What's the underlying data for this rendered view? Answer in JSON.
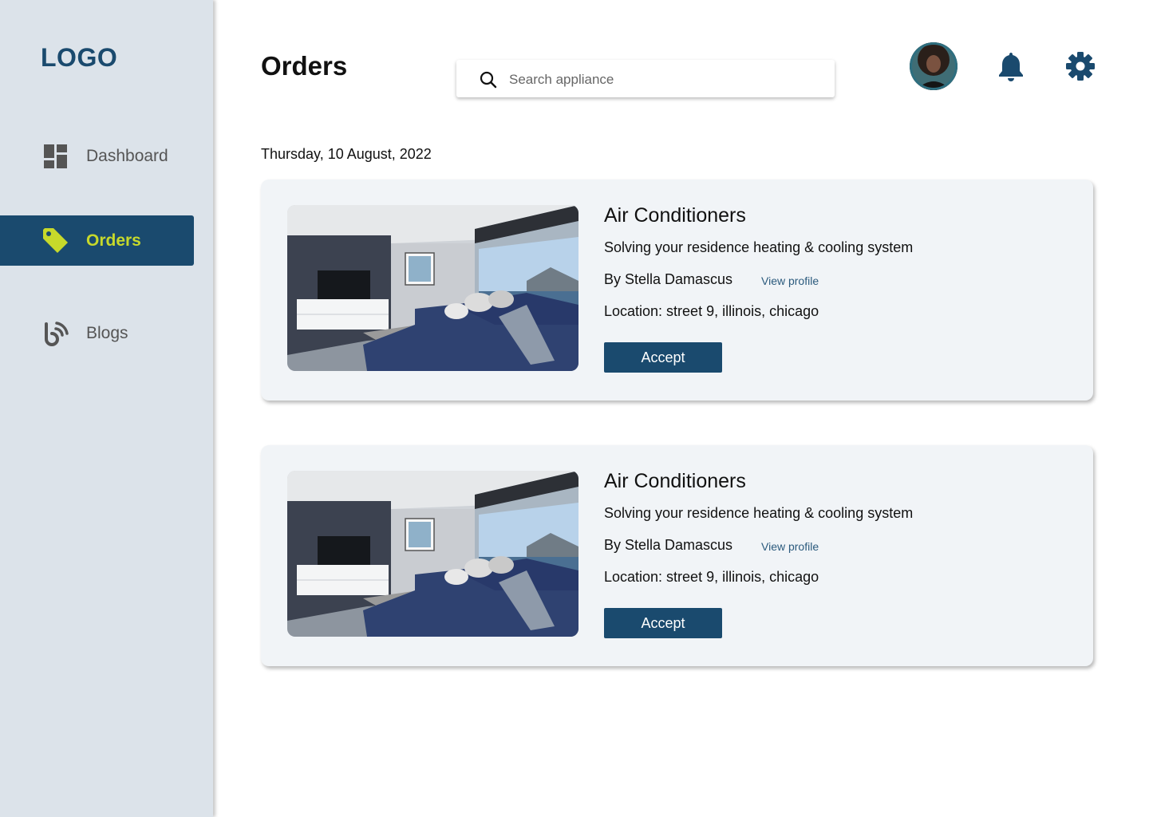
{
  "app": {
    "logo": "LOGO"
  },
  "colors": {
    "primary": "#1a4a6e",
    "accent": "#c7d92b",
    "sidebar_bg": "#dce3ea",
    "card_bg": "#f1f4f7"
  },
  "sidebar": {
    "items": [
      {
        "label": "Dashboard",
        "icon": "dashboard-grid-icon",
        "active": false
      },
      {
        "label": "Orders",
        "icon": "tag-icon",
        "active": true
      },
      {
        "label": "Blogs",
        "icon": "blog-feed-icon",
        "active": false
      }
    ]
  },
  "header": {
    "title": "Orders",
    "search": {
      "placeholder": "Search appliance",
      "value": ""
    },
    "icons": [
      "avatar",
      "bell-icon",
      "gear-icon"
    ]
  },
  "main": {
    "date": "Thursday, 10 August, 2022",
    "orders": [
      {
        "title": "Air Conditioners",
        "description": "Solving your residence heating & cooling system",
        "by": "By Stella Damascus",
        "profile_link": "View profile",
        "location": "Location: street 9, illinois, chicago",
        "action": "Accept"
      },
      {
        "title": "Air Conditioners",
        "description": "Solving your residence heating & cooling system",
        "by": "By Stella Damascus",
        "profile_link": "View profile",
        "location": "Location: street 9, illinois, chicago",
        "action": "Accept"
      }
    ]
  }
}
